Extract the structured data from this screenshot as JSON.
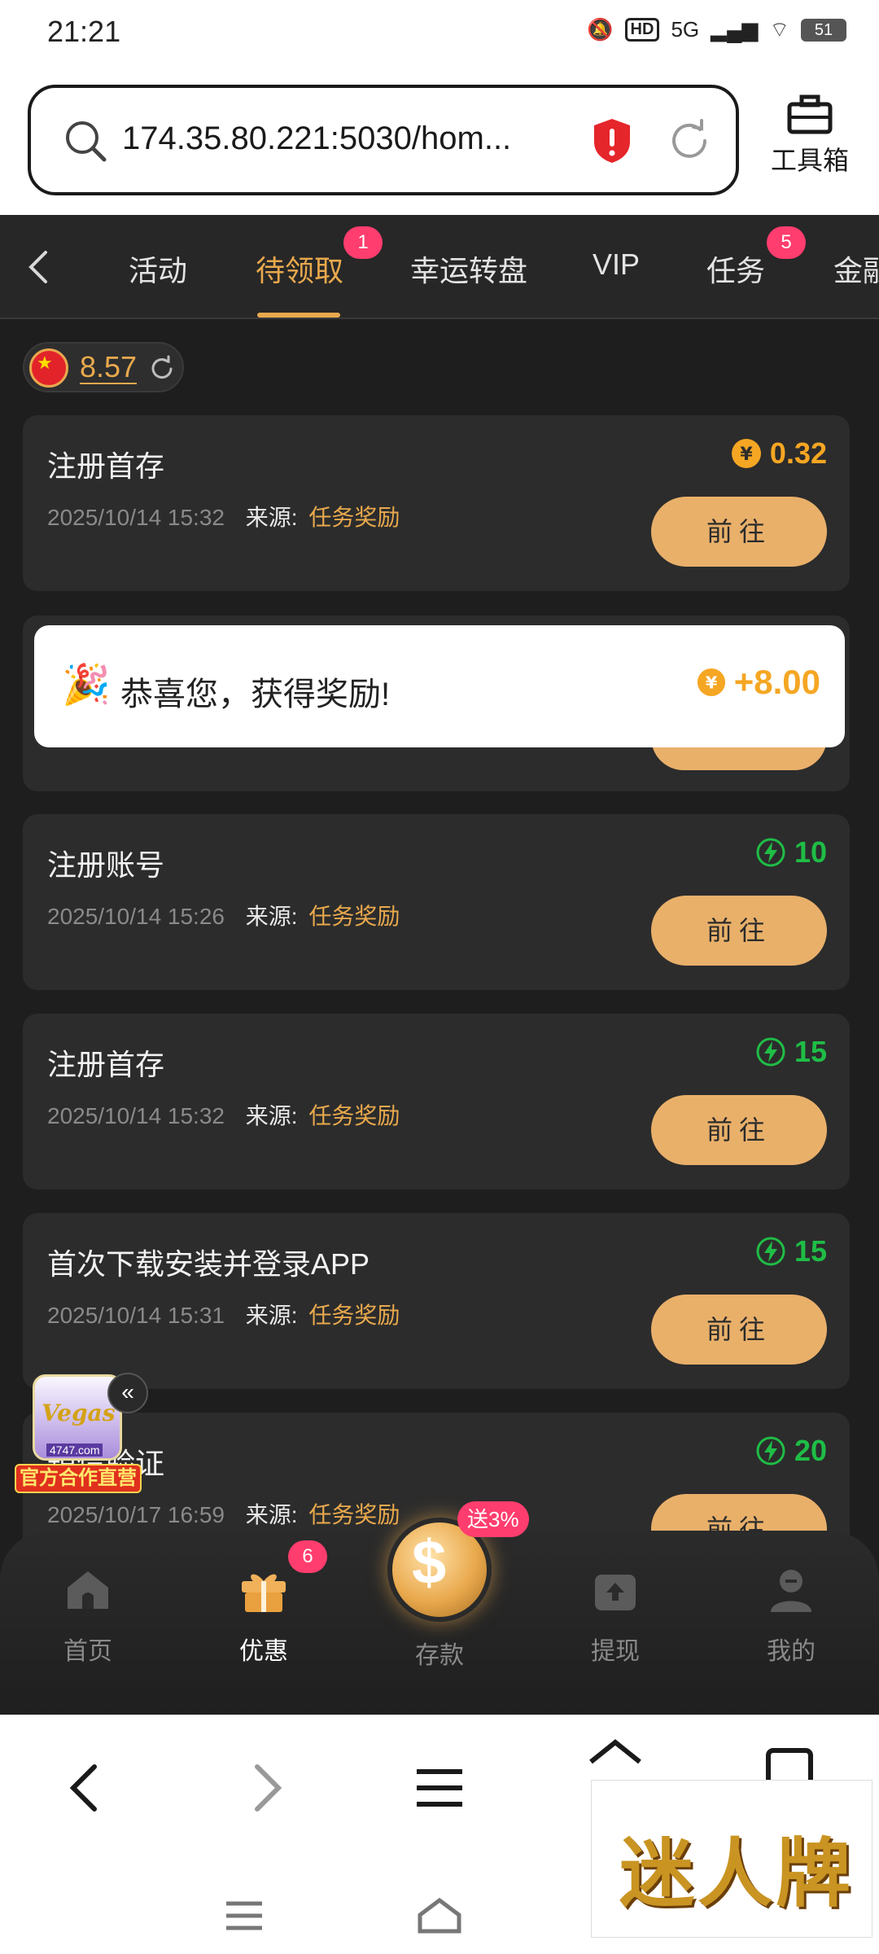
{
  "status_bar": {
    "time": "21:21",
    "network": "5G",
    "hd": "HD",
    "battery": "51"
  },
  "browser": {
    "url": "174.35.80.221:5030/hom...",
    "toolbox_label": "工具箱"
  },
  "tabs": [
    {
      "label": "活动",
      "badge": null,
      "active": false
    },
    {
      "label": "待领取",
      "badge": "1",
      "active": true
    },
    {
      "label": "幸运转盘",
      "badge": null,
      "active": false
    },
    {
      "label": "VIP",
      "badge": null,
      "active": false
    },
    {
      "label": "任务",
      "badge": "5",
      "active": false
    },
    {
      "label": "金融",
      "badge": null,
      "active": false
    }
  ],
  "balance": {
    "value": "8.57",
    "currency_flag": "china-flag-icon"
  },
  "cards": [
    {
      "title": "注册首存",
      "date": "2025/10/14 15:32",
      "source_label": "来源:",
      "source": "任务奖励",
      "reward": "0.32",
      "reward_type": "coin",
      "button": "前往"
    },
    {
      "title": "",
      "date": "",
      "source_label": "",
      "source": "",
      "reward": "",
      "reward_type": "coin",
      "button": ""
    },
    {
      "title": "注册账号",
      "date": "2025/10/14 15:26",
      "source_label": "来源:",
      "source": "任务奖励",
      "reward": "10",
      "reward_type": "bolt",
      "button": "前往"
    },
    {
      "title": "注册首存",
      "date": "2025/10/14 15:32",
      "source_label": "来源:",
      "source": "任务奖励",
      "reward": "15",
      "reward_type": "bolt",
      "button": "前往"
    },
    {
      "title": "首次下载安装并登录APP",
      "date": "2025/10/14 15:31",
      "source_label": "来源:",
      "source": "任务奖励",
      "reward": "15",
      "reward_type": "bolt",
      "button": "前往"
    },
    {
      "title": "短信验证",
      "date": "2025/10/17 16:59",
      "source_label": "来源:",
      "source": "任务奖励",
      "reward": "20",
      "reward_type": "bolt",
      "button": "前往"
    }
  ],
  "toast": {
    "text": "恭喜您，获得奖励!",
    "reward": "+8.00"
  },
  "float_ad": {
    "logo_text": "Vegas",
    "url": "4747.com",
    "label": "官方合作直营"
  },
  "bottom_nav": {
    "items": [
      {
        "label": "首页",
        "icon": "home-icon"
      },
      {
        "label": "优惠",
        "icon": "gift-icon",
        "badge": "6"
      },
      {
        "label": "存款",
        "icon": "deposit-coin-icon",
        "tag": "送3%"
      },
      {
        "label": "提现",
        "icon": "withdraw-icon"
      },
      {
        "label": "我的",
        "icon": "profile-icon"
      }
    ]
  },
  "brand_ad": {
    "text": "迷人牌"
  }
}
